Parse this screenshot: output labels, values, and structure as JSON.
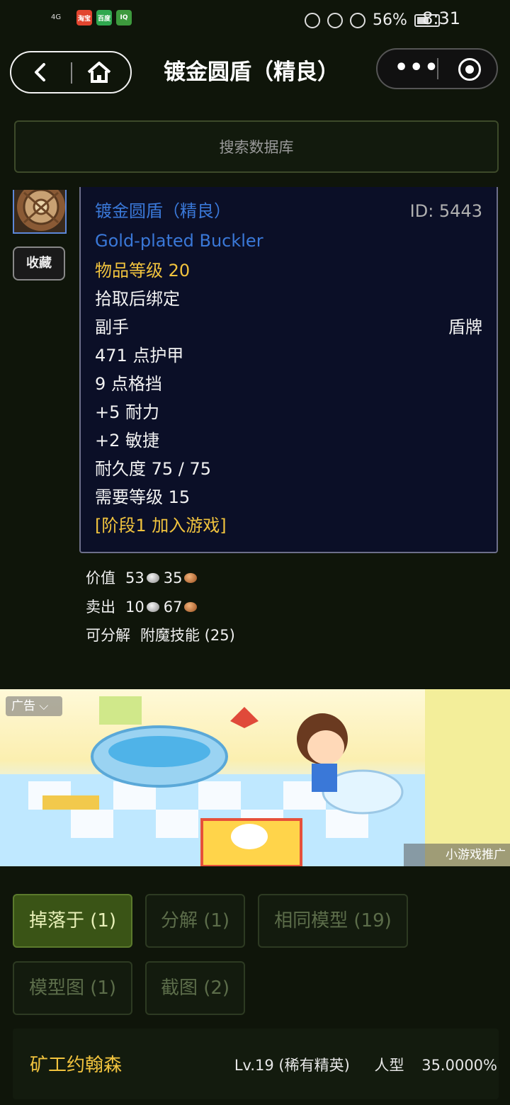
{
  "status_bar": {
    "network": "4G",
    "battery": "56%",
    "battery_level": 0.56,
    "time": "8:31",
    "apps": [
      "淘宝",
      "百度",
      "IQ"
    ]
  },
  "nav": {
    "title": "镀金圆盾（精良）",
    "more_glyph": "•••"
  },
  "search": {
    "placeholder": "搜索数据库"
  },
  "favorite_label": "收藏",
  "item": {
    "name_cn": "镀金圆盾（精良）",
    "id": "ID: 5443",
    "name_en": "Gold-plated Buckler",
    "item_level": "物品等级 20",
    "bind": "拾取后绑定",
    "slot": "副手",
    "type": "盾牌",
    "armor": "471 点护甲",
    "block": "9 点格挡",
    "stamina": "+5 耐力",
    "agility": "+2 敏捷",
    "durability": "耐久度 75 / 75",
    "req_level": "需要等级 15",
    "phase": "[阶段1 加入游戏]",
    "colors": {
      "name": "#3a78d8",
      "phase": "#f1c33e",
      "item_level": "#f1c33e"
    }
  },
  "value": {
    "value_label": "价值",
    "value_silver": "53",
    "value_copper": "35",
    "sell_label": "卖出",
    "sell_silver": "10",
    "sell_copper": "67",
    "disenchant_label": "可分解",
    "disenchant_value": "附魔技能 (25)"
  },
  "ad": {
    "tag": "广告 ⌵",
    "promo": "小游戏推广"
  },
  "tabs": [
    {
      "label": "掉落于 (1)",
      "active": true
    },
    {
      "label": "分解 (1)",
      "active": false
    },
    {
      "label": "相同模型 (19)",
      "active": false
    },
    {
      "label": "模型图 (1)",
      "active": false
    },
    {
      "label": "截图 (2)",
      "active": false
    }
  ],
  "drop": {
    "name": "矿工约翰森",
    "level": "Lv.19 (稀有精英)",
    "type": "人型",
    "chance": "35.0000%"
  }
}
